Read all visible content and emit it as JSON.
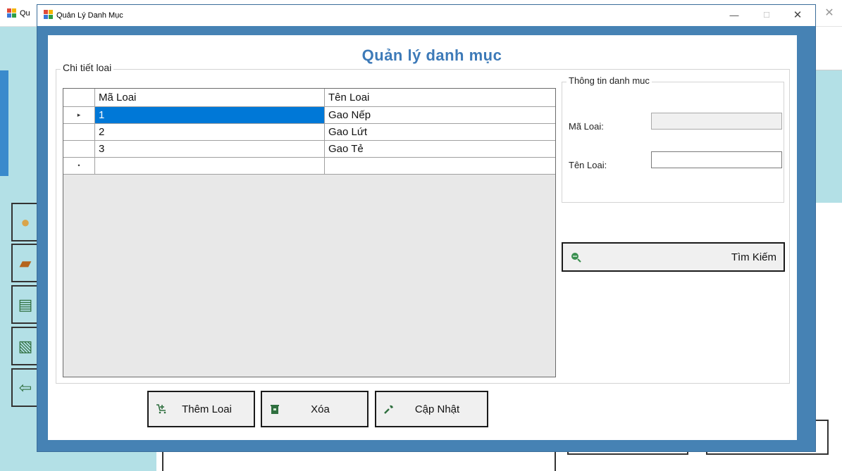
{
  "background_window": {
    "title": "Qu",
    "close_glyph": "✕"
  },
  "dialog": {
    "title": "Quản Lý Danh Mục",
    "min_glyph": "—",
    "max_glyph": "☐",
    "close_glyph": "✕"
  },
  "main": {
    "heading": "Quản lý danh mục",
    "detail_group_label": "Chi tiết loai"
  },
  "grid": {
    "columns": [
      "Mã Loai",
      "Tên Loai"
    ],
    "rows": [
      {
        "id": "1",
        "name": "Gao Nếp",
        "selected": true
      },
      {
        "id": "2",
        "name": "Gao Lứt",
        "selected": false
      },
      {
        "id": "3",
        "name": "Gao Tẻ",
        "selected": false
      }
    ],
    "current_row_glyph": "▸",
    "new_row_glyph": "•"
  },
  "info": {
    "group_label": "Thông tin danh muc",
    "ma_loai_label": "Mã Loai:",
    "ma_loai_value": "",
    "ten_loai_label": "Tên Loai:",
    "ten_loai_value": ""
  },
  "buttons": {
    "search": "Tìm Kiếm",
    "add": "Thêm Loai",
    "delete": "Xóa",
    "update": "Cập Nhật"
  },
  "icons": {
    "search": "search-icon",
    "add": "cart-add-icon",
    "delete": "trash-icon",
    "update": "wrench-icon"
  },
  "colors": {
    "dialog_frame": "#4682b4",
    "heading": "#3d7ab8",
    "selection": "#0078d7",
    "sidebar": "#b3e0e6"
  }
}
